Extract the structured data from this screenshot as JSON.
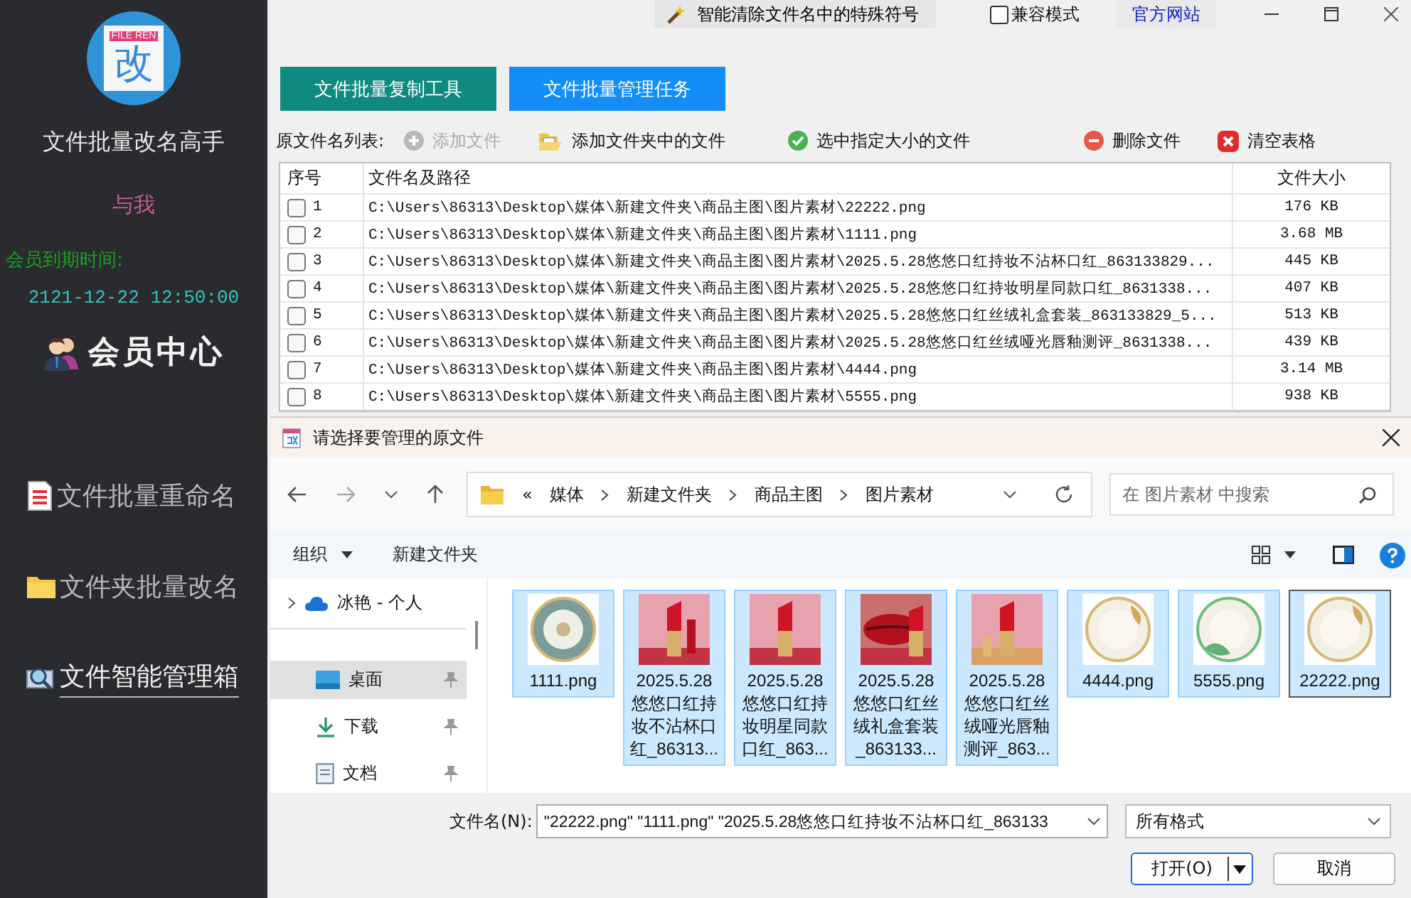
{
  "sidebar": {
    "logo": {
      "badge": "FILE REN",
      "glyph": "改"
    },
    "app_name": "文件批量改名高手",
    "user": "与我",
    "expiry_label": "会员到期时间:",
    "expiry_time": "2121-12-22 12:50:00",
    "member_center": "会员中心",
    "nav": [
      {
        "label": "文件批量重命名",
        "selected": false
      },
      {
        "label": "文件夹批量改名",
        "selected": false
      },
      {
        "label": "文件智能管理箱",
        "selected": true
      }
    ]
  },
  "top_bar": {
    "clean_button": "智能清除文件名中的特殊符号",
    "compat": {
      "label": "兼容模式",
      "checked": false
    },
    "website_link": "官方网站"
  },
  "mode_tabs": [
    {
      "label": "文件批量复制工具",
      "selected": false
    },
    {
      "label": "文件批量管理任务",
      "selected": true
    }
  ],
  "toolbar": {
    "label": "原文件名列表:",
    "actions": [
      {
        "label": "添加文件",
        "kind": "add",
        "disabled": true
      },
      {
        "label": "添加文件夹中的文件",
        "kind": "folder",
        "disabled": false
      },
      {
        "label": "选中指定大小的文件",
        "kind": "check",
        "disabled": false
      },
      {
        "label": "删除文件",
        "kind": "remove",
        "disabled": false
      },
      {
        "label": "清空表格",
        "kind": "clear",
        "disabled": false
      }
    ]
  },
  "table": {
    "columns": [
      "序号",
      "文件名及路径",
      "文件大小"
    ],
    "rows": [
      {
        "index": "1",
        "path": "C:\\Users\\86313\\Desktop\\媒体\\新建文件夹\\商品主图\\图片素材\\22222.png",
        "size": "176 KB",
        "checked": false
      },
      {
        "index": "2",
        "path": "C:\\Users\\86313\\Desktop\\媒体\\新建文件夹\\商品主图\\图片素材\\1111.png",
        "size": "3.68 MB",
        "checked": false
      },
      {
        "index": "3",
        "path": "C:\\Users\\86313\\Desktop\\媒体\\新建文件夹\\商品主图\\图片素材\\2025.5.28悠悠口红持妆不沾杯口红_863133829...",
        "size": "445 KB",
        "checked": false
      },
      {
        "index": "4",
        "path": "C:\\Users\\86313\\Desktop\\媒体\\新建文件夹\\商品主图\\图片素材\\2025.5.28悠悠口红持妆明星同款口红_8631338...",
        "size": "407 KB",
        "checked": false
      },
      {
        "index": "5",
        "path": "C:\\Users\\86313\\Desktop\\媒体\\新建文件夹\\商品主图\\图片素材\\2025.5.28悠悠口红丝绒礼盒套装_863133829_5...",
        "size": "513 KB",
        "checked": false
      },
      {
        "index": "6",
        "path": "C:\\Users\\86313\\Desktop\\媒体\\新建文件夹\\商品主图\\图片素材\\2025.5.28悠悠口红丝绒哑光唇釉测评_8631338...",
        "size": "439 KB",
        "checked": false
      },
      {
        "index": "7",
        "path": "C:\\Users\\86313\\Desktop\\媒体\\新建文件夹\\商品主图\\图片素材\\4444.png",
        "size": "3.14 MB",
        "checked": false
      },
      {
        "index": "8",
        "path": "C:\\Users\\86313\\Desktop\\媒体\\新建文件夹\\商品主图\\图片素材\\5555.png",
        "size": "938 KB",
        "checked": false
      }
    ]
  },
  "dialog": {
    "title": "请选择要管理的原文件",
    "breadcrumb": [
      "«",
      "媒体",
      "新建文件夹",
      "商品主图",
      "图片素材"
    ],
    "search": {
      "placeholder": "在 图片素材 中搜索"
    },
    "commands": {
      "organize": "组织",
      "new_folder": "新建文件夹"
    },
    "nav_pane": [
      {
        "label": "冰艳 - 个人",
        "kind": "cloud",
        "selected": false
      },
      {
        "label": "桌面",
        "kind": "desktop",
        "selected": true
      },
      {
        "label": "下载",
        "kind": "download",
        "selected": false
      },
      {
        "label": "文档",
        "kind": "document",
        "selected": false
      }
    ],
    "files": [
      {
        "name": "1111.png",
        "selected": true,
        "focused": false
      },
      {
        "name": "2025.5.28悠悠口红持妆不沾杯口红_86313...",
        "selected": true,
        "focused": false
      },
      {
        "name": "2025.5.28悠悠口红持妆明星同款口红_863...",
        "selected": true,
        "focused": false
      },
      {
        "name": "2025.5.28悠悠口红丝绒礼盒套装_863133...",
        "selected": true,
        "focused": false
      },
      {
        "name": "2025.5.28悠悠口红丝绒哑光唇釉测评_863...",
        "selected": true,
        "focused": false
      },
      {
        "name": "4444.png",
        "selected": true,
        "focused": false
      },
      {
        "name": "5555.png",
        "selected": true,
        "focused": false
      },
      {
        "name": "22222.png",
        "selected": true,
        "focused": true
      }
    ],
    "file_name_label": "文件名(N):",
    "file_name_value": "\"22222.png\" \"1111.png\" \"2025.5.28悠悠口红持妆不沾杯口红_863133",
    "file_type": "所有格式",
    "open_button": "打开(O)",
    "cancel_button": "取消"
  }
}
